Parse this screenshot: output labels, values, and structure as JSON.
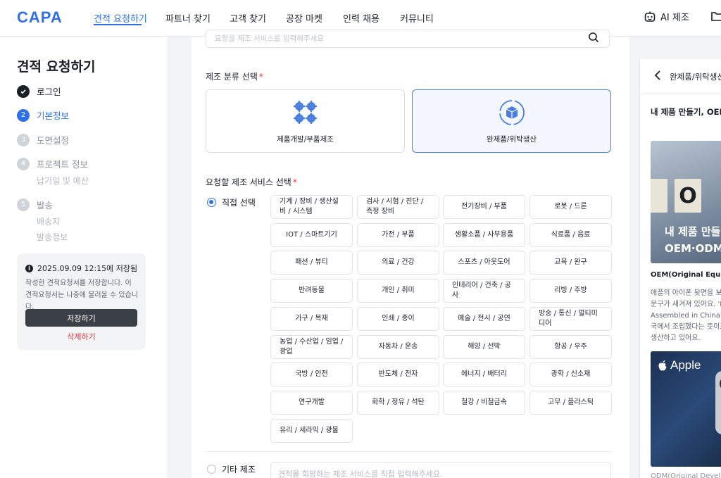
{
  "nav": {
    "logo": "CAPA",
    "items": [
      "견적 요청하기",
      "파트너 찾기",
      "고객 찾기",
      "공장 마켓",
      "인력 채용",
      "커뮤니티"
    ],
    "ai_label": "AI 제조"
  },
  "sidebar": {
    "title": "견적 요청하기",
    "steps": [
      {
        "num": "",
        "label": "로그인",
        "state": "done"
      },
      {
        "num": "2",
        "label": "기본정보",
        "state": "active"
      },
      {
        "num": "3",
        "label": "도면설정",
        "state": "todo"
      },
      {
        "num": "4",
        "label": "프로젝트 정보",
        "state": "todo"
      },
      {
        "num": "5",
        "label": "발송",
        "state": "todo"
      }
    ],
    "substeps": {
      "project": [
        "납기일 및 예산"
      ],
      "send": [
        "배송지",
        "발송정보"
      ]
    },
    "save_card": {
      "saved_at": "2025.09.09 12:15에 저장됨",
      "desc": "작성한 견적요청서를 저장합니다. 이 견적요청서는 나중에 불러올 수 있습니다.",
      "save_label": "저장하기",
      "delete_label": "삭제하기"
    }
  },
  "main": {
    "search_placeholder": "요청을 제조 서비스를 입력해주세요",
    "category_label": "제조 분류 선택",
    "categories": [
      {
        "label": "제품개발/부품제조",
        "selected": false
      },
      {
        "label": "완제품/위탁생산",
        "selected": true
      }
    ],
    "service_label": "요청할 제조 서비스 선택",
    "direct_label": "직접 선택",
    "services": [
      "기계 / 장비 / 생산설비 / 시스템",
      "검사 / 시험 / 진단 / 측정 장비",
      "전기장비 / 부품",
      "로봇 / 드론",
      "IOT / 스마트기기",
      "가전 / 부품",
      "생활소품 / 사무용품",
      "식료품 / 음료",
      "패션 / 뷰티",
      "의료 / 건강",
      "스포츠 / 아웃도어",
      "교육 / 완구",
      "반려동물",
      "개인 / 취미",
      "인테리어 / 건축 / 공사",
      "리빙 / 주방",
      "가구 / 목재",
      "인쇄 / 종이",
      "예술 / 전시 / 공연",
      "방송 / 통신 / 멀티미디어",
      "농업 / 수산업 / 임업 / 광업",
      "자동차 / 운송",
      "해양 / 선박",
      "항공 / 우주",
      "국방 / 안전",
      "반도체 / 전자",
      "에너지 / 배터리",
      "광학 / 신소재",
      "연구개발",
      "화학 / 정유 / 석탄",
      "철강 / 비철금속",
      "고무 / 플라스틱",
      "유리 / 세라믹 / 광물"
    ],
    "other_label": "기타 제조",
    "other_placeholder": "견적을 희망하는 제조 서비스를 직접 입력해주세요."
  },
  "right_panel": {
    "title": "완제품/위탁생산",
    "subtitle": "내 제품 만들기, OEM",
    "image1_lines": [
      "내 제품 만들",
      "OEM·ODM"
    ],
    "image1_letter": "O",
    "oem_heading": "OEM(Original Equipm",
    "body_lines": [
      "애플의 아이폰 뒷면을 보",
      "문구가 새겨져 있어요. 'D",
      "Assembled in China' 는",
      "국에서 조립했다는 뜻이죠",
      "생산하고 있어요."
    ],
    "image2_brand": "Apple",
    "footer": "ODM(Original Develo"
  },
  "colors": {
    "accent": "#2f6fe9",
    "danger": "#e03a3a",
    "selected_bg": "#f4f7fd"
  }
}
